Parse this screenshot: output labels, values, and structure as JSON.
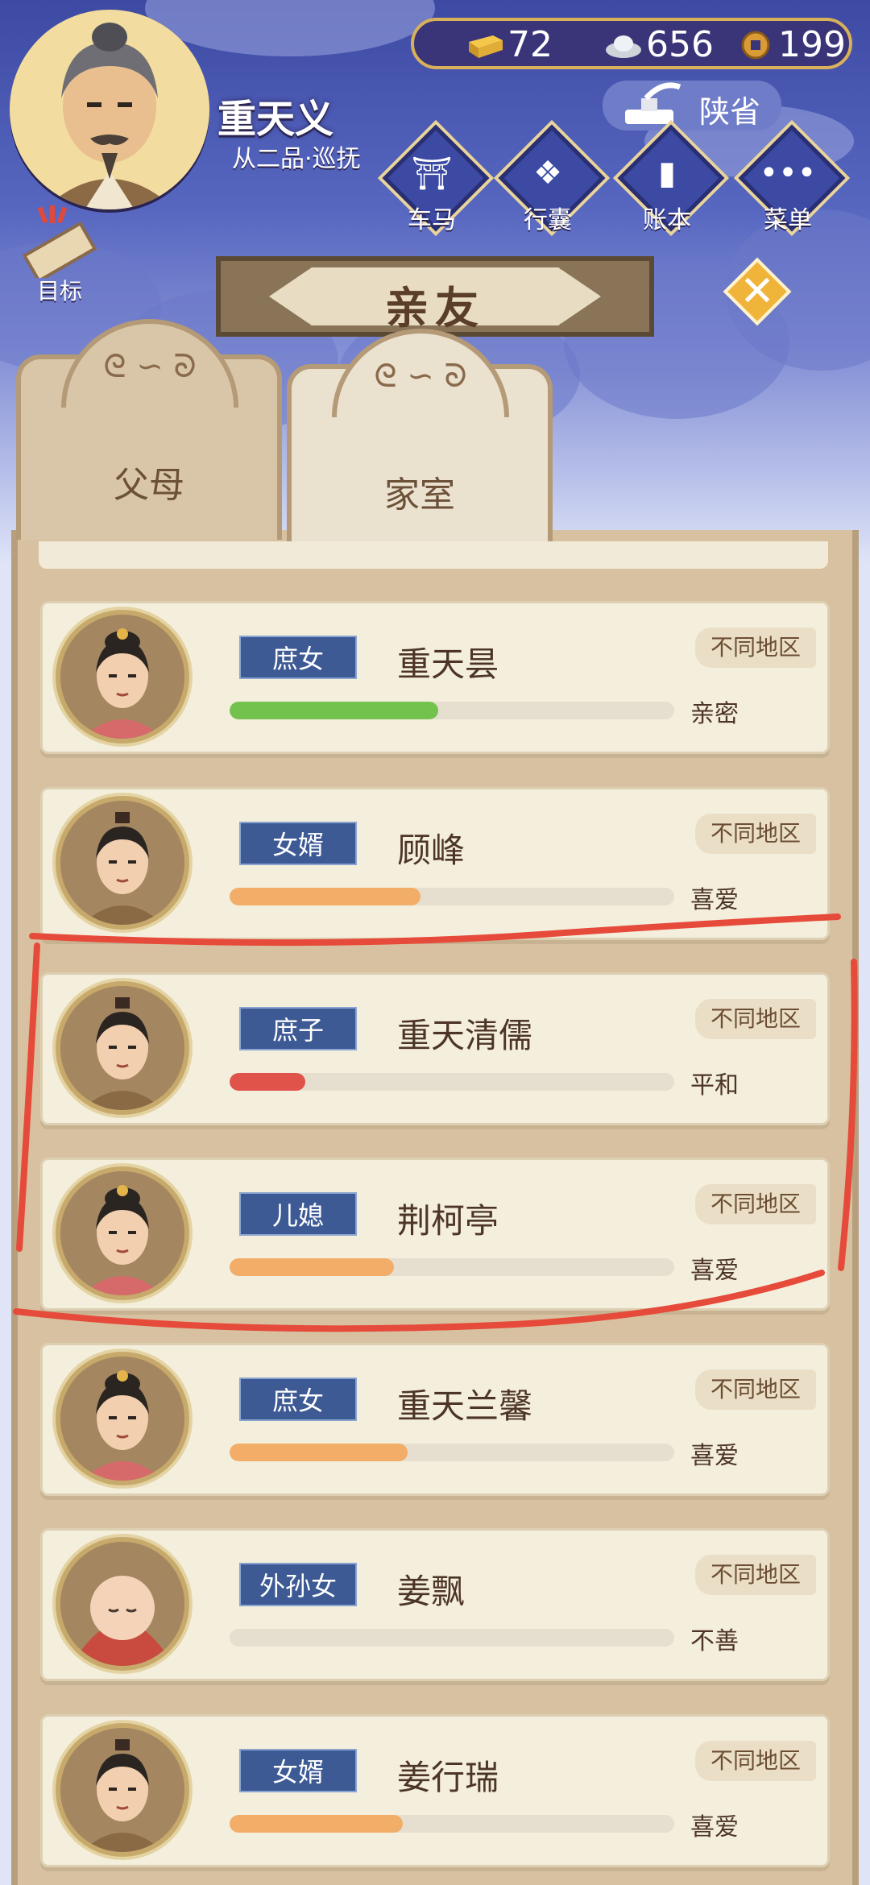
{
  "header": {
    "character_name": "重天义",
    "character_title": "从二品·巡抚",
    "goal_label": "目标",
    "region": "陕省"
  },
  "currency": {
    "gold": "72",
    "silver": "656",
    "coins": "199"
  },
  "menu": [
    {
      "label": "车马",
      "icon": "carriage-icon"
    },
    {
      "label": "行囊",
      "icon": "bundle-icon"
    },
    {
      "label": "账本",
      "icon": "ledger-icon"
    },
    {
      "label": "菜单",
      "icon": "more-icon"
    }
  ],
  "page_title": "亲友",
  "tabs": [
    {
      "label": "父母",
      "active": false
    },
    {
      "label": "家室",
      "active": true
    }
  ],
  "relatives": [
    {
      "role": "庶女",
      "name": "重天昙",
      "region": "不同地区",
      "relation": "亲密",
      "progress": 0.47,
      "bar_color": "#74c24e",
      "gender": "female"
    },
    {
      "role": "女婿",
      "name": "顾峰",
      "region": "不同地区",
      "relation": "喜爱",
      "progress": 0.43,
      "bar_color": "#f2ad68",
      "gender": "male"
    },
    {
      "role": "庶子",
      "name": "重天清儒",
      "region": "不同地区",
      "relation": "平和",
      "progress": 0.17,
      "bar_color": "#e0534a",
      "gender": "male"
    },
    {
      "role": "儿媳",
      "name": "荆柯亭",
      "region": "不同地区",
      "relation": "喜爱",
      "progress": 0.37,
      "bar_color": "#f2ad68",
      "gender": "female"
    },
    {
      "role": "庶女",
      "name": "重天兰馨",
      "region": "不同地区",
      "relation": "喜爱",
      "progress": 0.4,
      "bar_color": "#f2ad68",
      "gender": "female"
    },
    {
      "role": "外孙女",
      "name": "姜飘",
      "region": "不同地区",
      "relation": "不善",
      "progress": 0.0,
      "bar_color": "#f2ad68",
      "gender": "baby"
    },
    {
      "role": "女婿",
      "name": "姜行瑞",
      "region": "不同地区",
      "relation": "喜爱",
      "progress": 0.39,
      "bar_color": "#f2ad68",
      "gender": "male"
    }
  ]
}
